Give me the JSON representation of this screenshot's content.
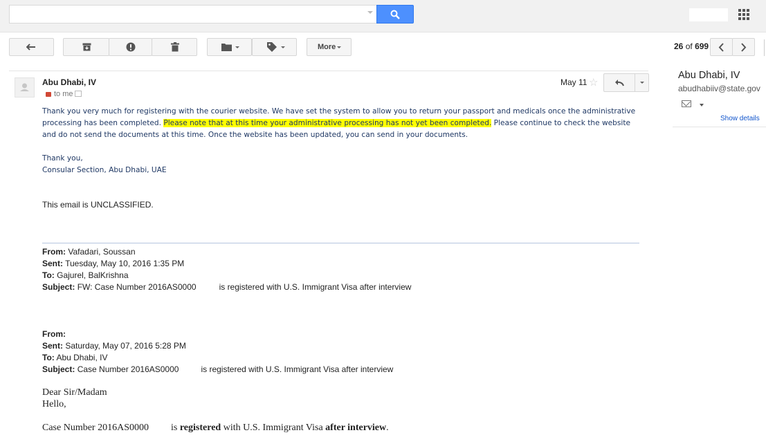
{
  "search": {
    "placeholder": ""
  },
  "toolbar": {
    "more_label": "More"
  },
  "pager": {
    "current": "26",
    "of_label": "of",
    "total": "699"
  },
  "message": {
    "sender": "Abu Dhabi, IV",
    "recipient": "to me",
    "date": "May 11",
    "body_pre": "Thank you very much for registering with the courier website.  We have set the system to allow you to return your passport and medicals once the administrative processing has been completed.  ",
    "body_highlight": "Please note that at this time your administrative processing has not yet been completed.",
    "body_post": "  Please continue to check the website and do not send the documents at this time.  Once the website has been updated, you can send in your documents.",
    "sign_off": "Thank you,",
    "signature": "Consular Section, Abu Dhabi, UAE",
    "classification": "This email is UNCLASSIFIED."
  },
  "forward_1": {
    "from_label": "From:",
    "from": "Vafadari, Soussan",
    "sent_label": "Sent:",
    "sent": "Tuesday, May 10, 2016 1:35 PM",
    "to_label": "To:",
    "to": "Gajurel, BalKrishna",
    "subject_label": "Subject:",
    "subject_a": "FW: Case Number 2016AS0000",
    "subject_b": "is registered with U.S. Immigrant Visa after interview"
  },
  "forward_2": {
    "from_label": "From:",
    "sent_label": "Sent:",
    "sent": "Saturday, May 07, 2016 5:28 PM",
    "to_label": "To:",
    "to": "Abu Dhabi, IV",
    "subject_label": "Subject:",
    "subject_a": "Case Number 2016AS0000",
    "subject_b": "is registered with U.S. Immigrant Visa after interview"
  },
  "original": {
    "salutation": "Dear Sir/Madam",
    "hello": "Hello,",
    "case_a": "Case Number 2016AS0000",
    "case_is": "is",
    "case_registered": "registered",
    "case_with": "with U.S. Immigrant Visa",
    "case_after": "after interview",
    "case_end": "."
  },
  "contact_panel": {
    "name": "Abu Dhabi, IV",
    "email": "abudhabiiv@state.gov",
    "details_link": "Show details"
  },
  "colors": {
    "accent": "#4d90fe",
    "highlight": "#ffff00",
    "body_text": "#1f3864",
    "link": "#15c"
  }
}
